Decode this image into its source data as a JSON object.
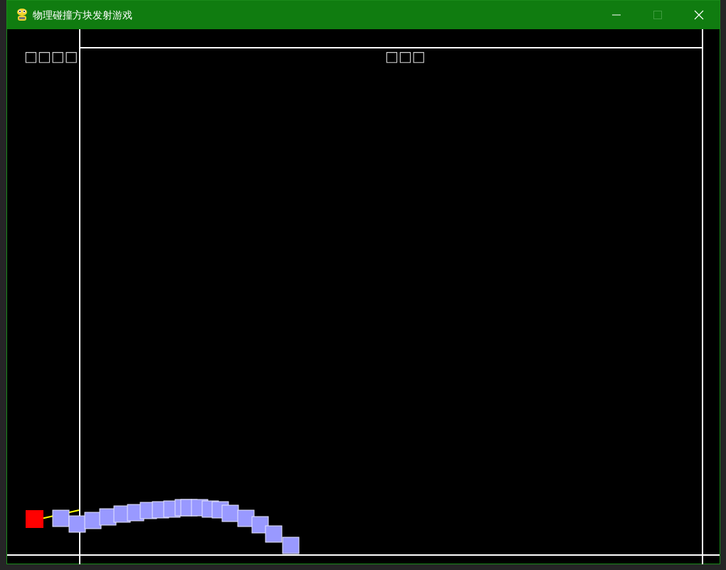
{
  "window": {
    "title": "物理碰撞方块发射游戏",
    "controls": [
      {
        "kind": "minimize",
        "disabled": false
      },
      {
        "kind": "maximize",
        "disabled": true
      },
      {
        "kind": "close",
        "disabled": false
      }
    ]
  },
  "game": {
    "left_panel_label": "□□□□",
    "field_label": "□□□"
  }
}
